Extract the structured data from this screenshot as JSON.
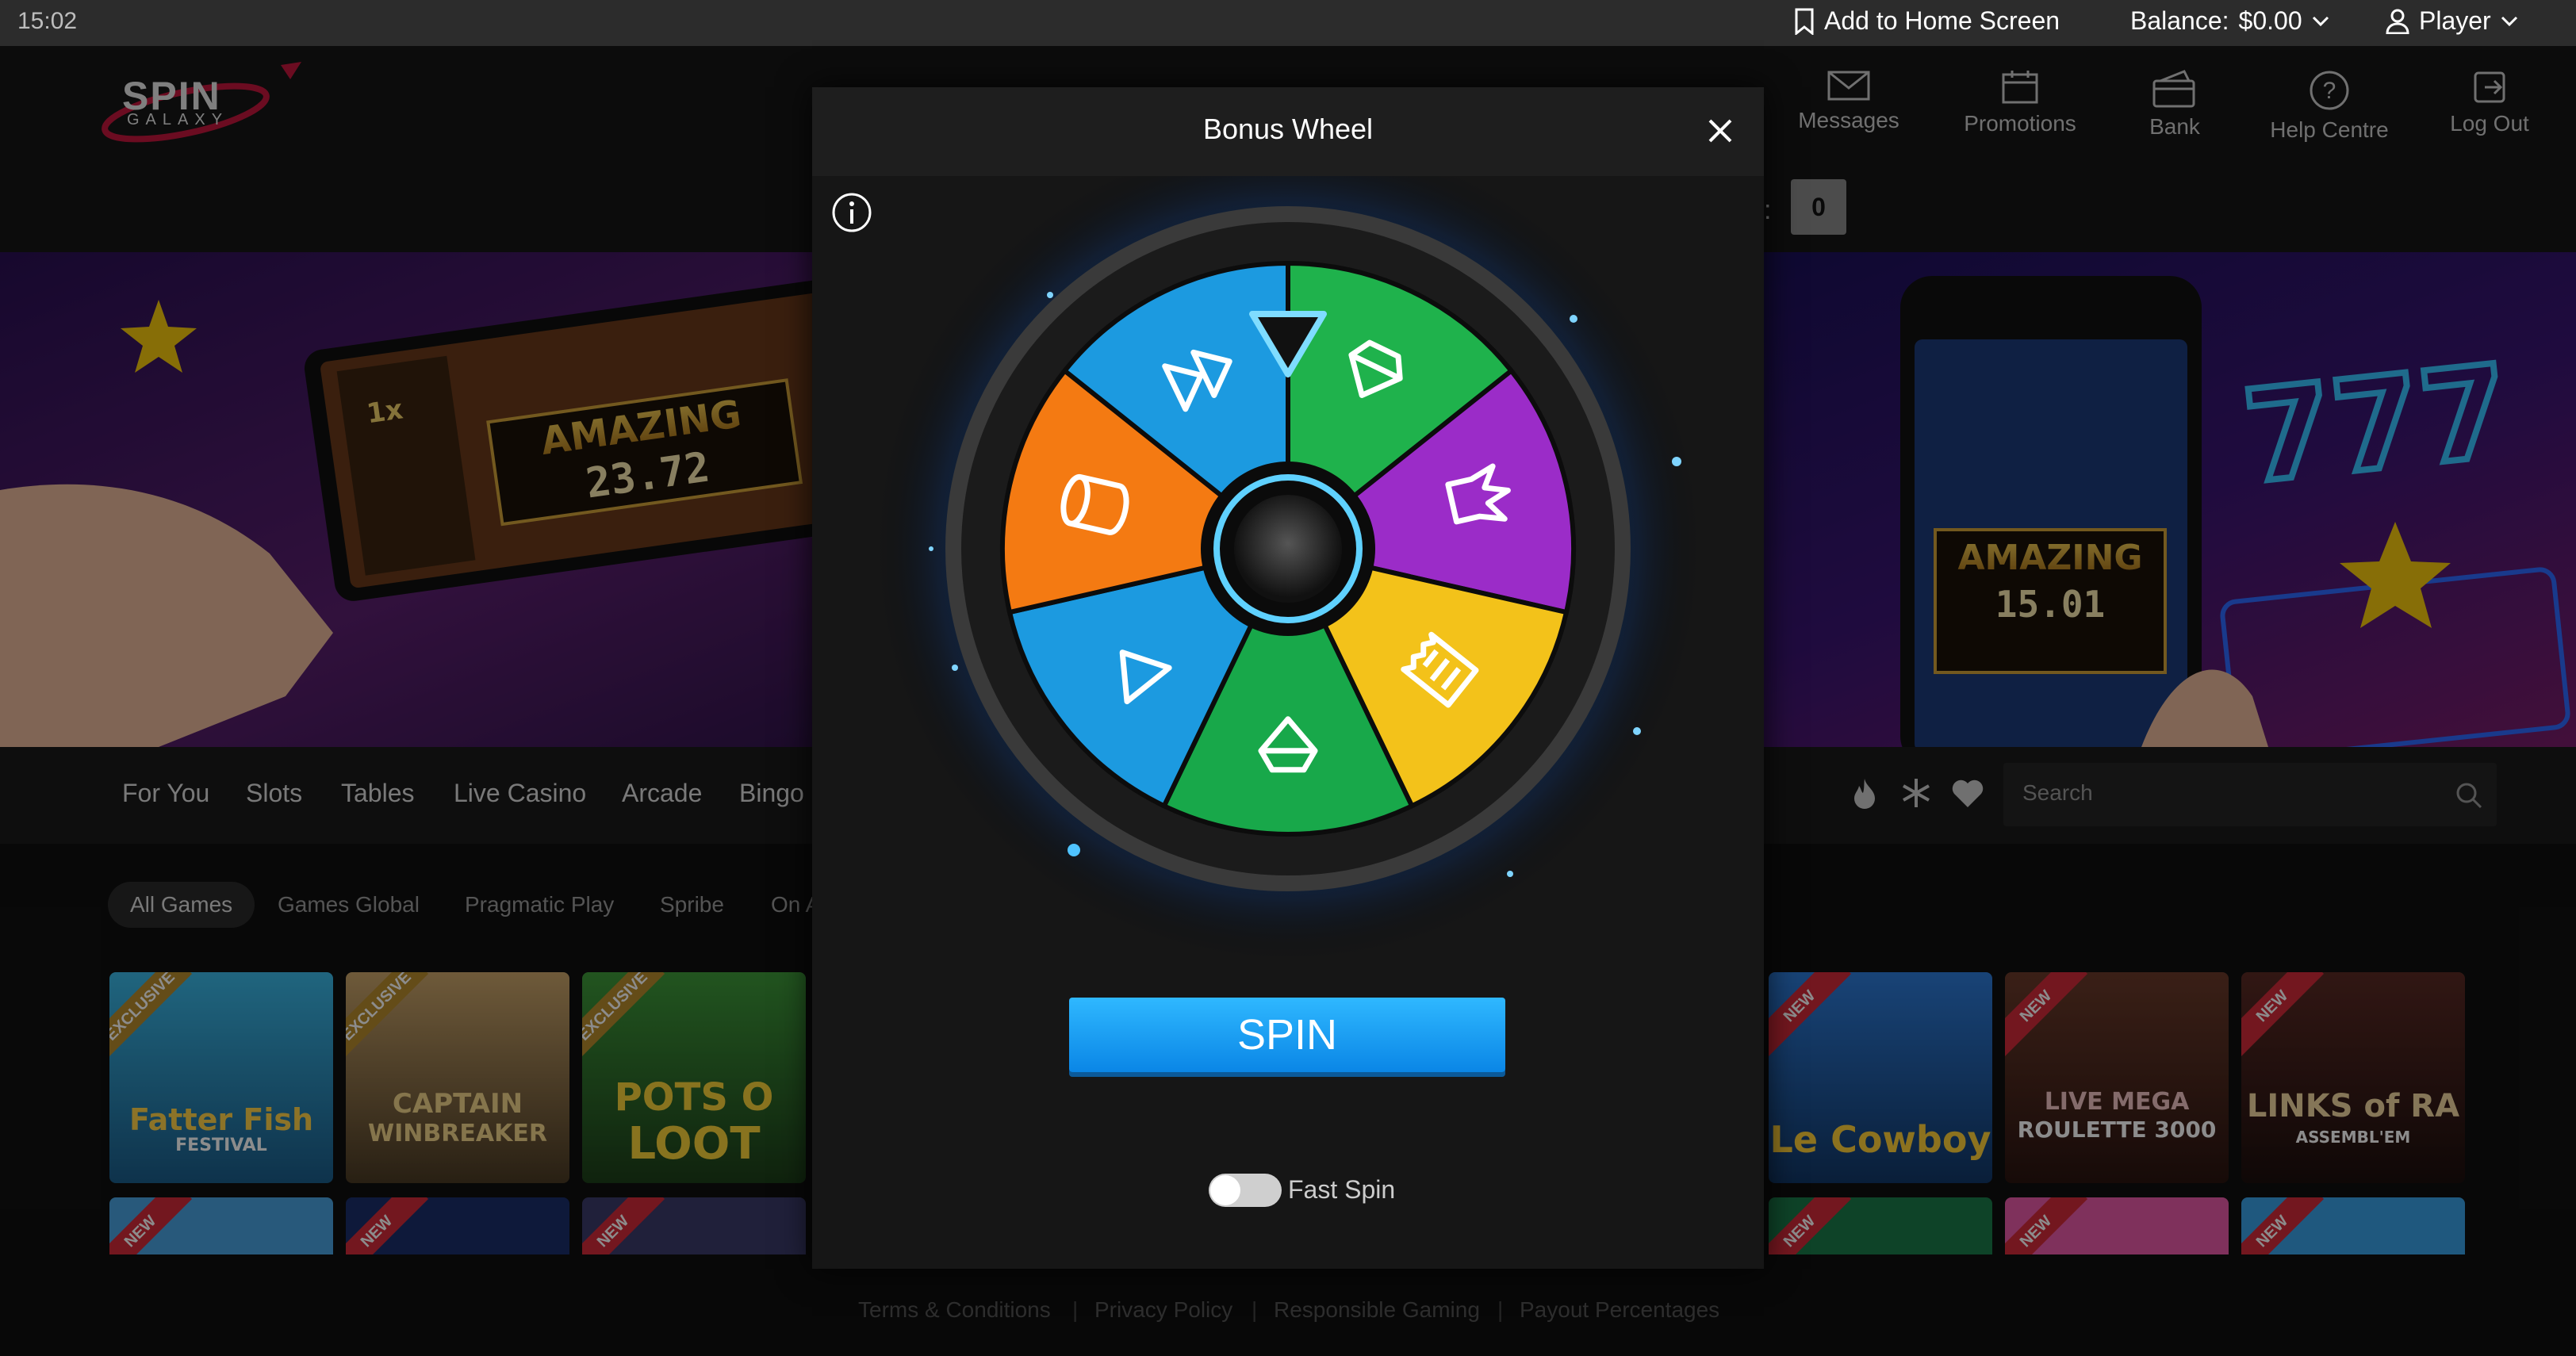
{
  "status_bar": {
    "time": "15:02",
    "add_to_home": "Add to Home Screen",
    "balance_label": "Balance:",
    "balance_value": "$0.00",
    "player": "Player"
  },
  "header": {
    "logo_top": "SPIN",
    "logo_bottom": "GALAXY",
    "buttons": [
      {
        "label": "Messages",
        "icon": "envelope-icon"
      },
      {
        "label": "Promotions",
        "icon": "calendar-icon"
      },
      {
        "label": "Bank",
        "icon": "wallet-icon"
      },
      {
        "label": "Help Centre",
        "icon": "question-icon"
      },
      {
        "label": "Log Out",
        "icon": "logout-icon"
      }
    ],
    "counter_value": "0"
  },
  "banner": {
    "left_game": {
      "amount": "23.72",
      "word": "AMAZING",
      "badge": "1x"
    },
    "right_game": {
      "amount": "15.01",
      "word": "AMAZING",
      "neon": "777"
    }
  },
  "nav": {
    "tabs": [
      "For You",
      "Slots",
      "Tables",
      "Live Casino",
      "Arcade",
      "Bingo"
    ],
    "search_placeholder": "Search"
  },
  "providers": [
    "All Games",
    "Games Global",
    "Pragmatic Play",
    "Spribe",
    "On A"
  ],
  "games_row1_left": [
    {
      "title": "Fatter Fish",
      "sub": "FESTIVAL",
      "ribbon": "EXCLUSIVE"
    },
    {
      "title": "CAPTAIN",
      "sub": "WINBREAKER",
      "ribbon": "EXCLUSIVE"
    },
    {
      "title": "POTS O",
      "sub": "LOOT",
      "ribbon": "EXCLUSIVE"
    }
  ],
  "games_row1_right": [
    {
      "title": "Le Cowboy",
      "sub": "",
      "ribbon": "NEW"
    },
    {
      "title": "LIVE MEGA",
      "sub": "ROULETTE 3000",
      "ribbon": "NEW"
    },
    {
      "title": "LINKS of RA",
      "sub": "ASSEMBL'EM",
      "ribbon": "NEW"
    }
  ],
  "games_row2_ribbon": "NEW",
  "modal": {
    "title": "Bonus Wheel",
    "spin_label": "SPIN",
    "fast_spin_label": "Fast Spin",
    "fast_spin_on": false,
    "segments": [
      {
        "color": "#1fb24c",
        "icon": "diamond-icon"
      },
      {
        "color": "#9b2cc8",
        "icon": "jester-hat-icon"
      },
      {
        "color": "#f3c21a",
        "icon": "receipt-icon"
      },
      {
        "color": "#18a84a",
        "icon": "diamond-icon"
      },
      {
        "color": "#1c9ae0",
        "icon": "play-arrow-icon"
      },
      {
        "color": "#f47a12",
        "icon": "coin-stack-icon"
      },
      {
        "color": "#1c9ae0",
        "icon": "double-arrow-icon"
      }
    ]
  },
  "footer": {
    "links": [
      "Terms & Conditions",
      "Privacy Policy",
      "Responsible Gaming",
      "Payout Percentages"
    ]
  }
}
